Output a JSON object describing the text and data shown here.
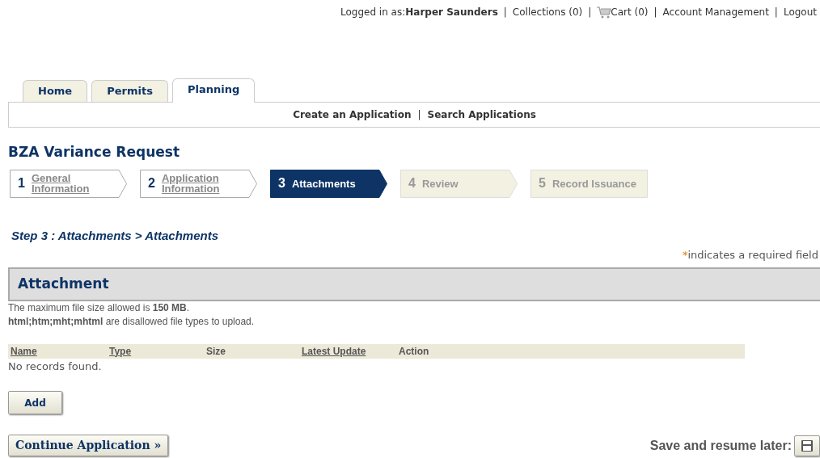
{
  "header": {
    "login_label": "Logged in as:",
    "user": "Harper Saunders",
    "links": [
      {
        "label": "|",
        "kind": "separator"
      },
      {
        "label": "Collections (0)",
        "kind": "text"
      },
      {
        "label": "|",
        "kind": "separator"
      },
      {
        "label": "Cart (0)",
        "kind": "cart"
      },
      {
        "label": "|",
        "kind": "separator"
      },
      {
        "label": "Account Management",
        "kind": "text"
      },
      {
        "label": "|",
        "kind": "separator"
      },
      {
        "label": "Logout",
        "kind": "text"
      }
    ]
  },
  "tabs": [
    {
      "label": "Home",
      "selected": false
    },
    {
      "label": "Permits",
      "selected": false
    },
    {
      "label": "Planning",
      "selected": true
    }
  ],
  "sub_links": [
    {
      "label": "Create an Application",
      "kind": "link"
    },
    {
      "label": "|",
      "kind": "separator"
    },
    {
      "label": "Search Applications",
      "kind": "link"
    }
  ],
  "page_title": "BZA Variance Request",
  "steps": [
    {
      "number": "1",
      "label": "General Information",
      "kind": "done"
    },
    {
      "number": "2",
      "label": "Application Information",
      "kind": "done"
    },
    {
      "number": "3",
      "label": "Attachments",
      "kind": "current"
    },
    {
      "number": "4",
      "label": "Review",
      "kind": "future"
    },
    {
      "number": "5",
      "label": "Record Issuance",
      "kind": "future"
    }
  ],
  "step_heading": "Step 3 : Attachments > Attachments",
  "required_note": {
    "mark": "*",
    "text": "indicates a required field"
  },
  "section_title": "Attachment",
  "notes": [
    "The maximum file size allowed is **150 MB**.",
    "**html;htm;mht;mhtml** are disallowed file types to upload."
  ],
  "table": {
    "columns": [
      {
        "label": "Name",
        "sortable": true
      },
      {
        "label": "Type",
        "sortable": true
      },
      {
        "label": "Size",
        "sortable": false
      },
      {
        "label": "Latest Update",
        "sortable": true
      },
      {
        "label": "Action",
        "sortable": false
      }
    ],
    "empty_text": "No records found."
  },
  "add_button": "Add",
  "continue_button": "Continue Application »",
  "save_label": "Save and resume later:"
}
